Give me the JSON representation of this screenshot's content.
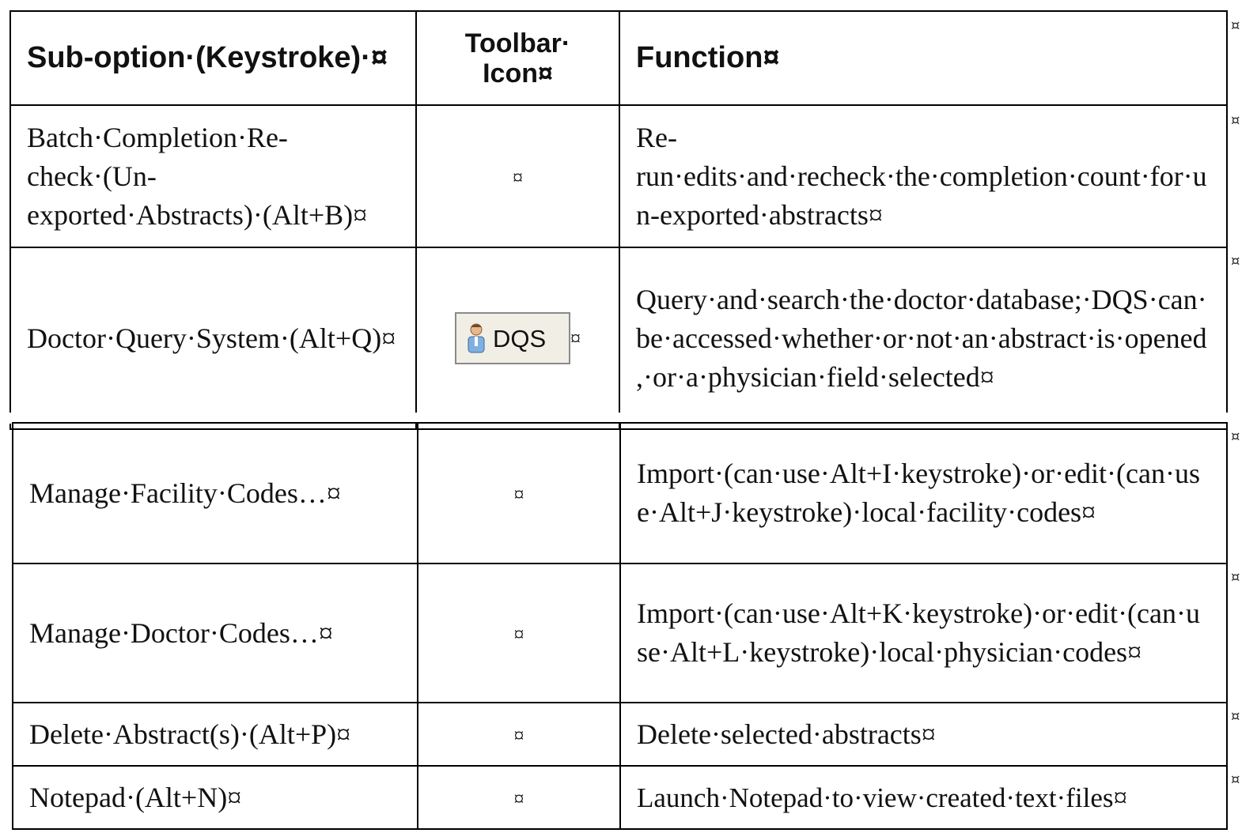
{
  "table": {
    "headers": [
      "Sub-option·(Keystroke)·¤",
      "Toolbar·Icon¤",
      "Function¤"
    ],
    "header_line1": "Toolbar·",
    "header_line2": "Icon¤",
    "rows": [
      {
        "sub_option": "Batch·Completion·Re-check·(Un-exported·Abstracts)·(Alt+B)¤",
        "icon_mark": "¤",
        "function": "Re-run·edits·and·recheck·the·completion·count·for·un-exported·abstracts¤"
      },
      {
        "sub_option": "Doctor·Query·System·(Alt+Q)¤",
        "icon_label": "DQS",
        "icon_name": "doctor-icon",
        "icon_mark": "¤",
        "function": "Query·and·search·the·doctor·database;·DQS·can·be·accessed·whether·or·not·an·abstract·is·opened,·or·a·physician·field·selected¤"
      },
      {
        "sub_option": "Manage·Facility·Codes…¤",
        "icon_mark": "¤",
        "function": "Import·(can·use·Alt+I·keystroke)·or·edit·(can·use·Alt+J·keystroke)·local·facility·codes¤"
      },
      {
        "sub_option": "Manage·Doctor·Codes…¤",
        "icon_mark": "¤",
        "function": "Import·(can·use·Alt+K·keystroke)·or·edit·(can·use·Alt+L·keystroke)·local·physician·codes¤"
      },
      {
        "sub_option": "Delete·Abstract(s)·(Alt+P)¤",
        "icon_mark": "¤",
        "function": "Delete·selected·abstracts¤"
      },
      {
        "sub_option": "Notepad·(Alt+N)¤",
        "icon_mark": "¤",
        "function": "Launch·Notepad·to·view·created·text·files¤"
      }
    ],
    "row_end_mark": "¤"
  },
  "colors": {
    "border": "#000000",
    "button_bg": "#f1efe5",
    "button_border": "#8a8a8a"
  }
}
